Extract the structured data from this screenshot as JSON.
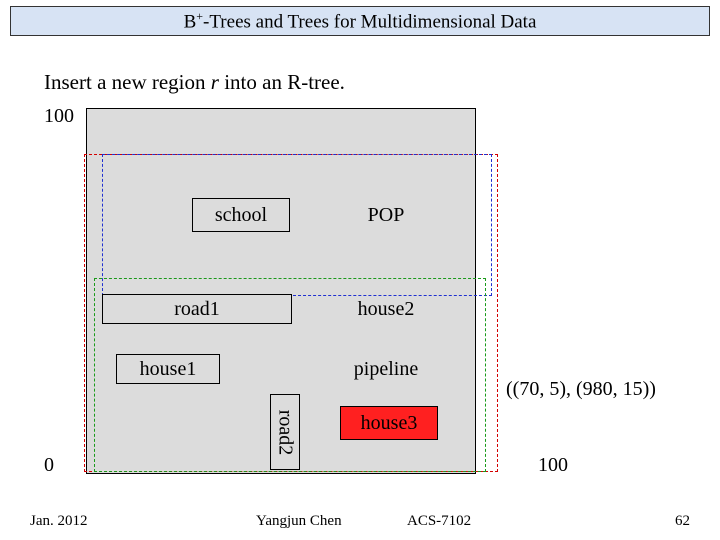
{
  "title": {
    "pre": "B",
    "sup": "+",
    "post": "-Trees and Trees for Multidimensional Data"
  },
  "subtitle": {
    "pre": "Insert a new region ",
    "var": "r",
    "post": " into an R-tree."
  },
  "axis": {
    "top": "100",
    "origin": "0",
    "right": "100"
  },
  "objects": {
    "school": "school",
    "pop": "POP",
    "road1": "road1",
    "house2": "house2",
    "house1": "house1",
    "pipeline": "pipeline",
    "road2": "road2",
    "house3": "house3"
  },
  "annotation": "((70, 5), (980, 15))",
  "footer": {
    "date": "Jan. 2012",
    "author": "Yangjun Chen",
    "course": "ACS-7102",
    "page": "62"
  }
}
